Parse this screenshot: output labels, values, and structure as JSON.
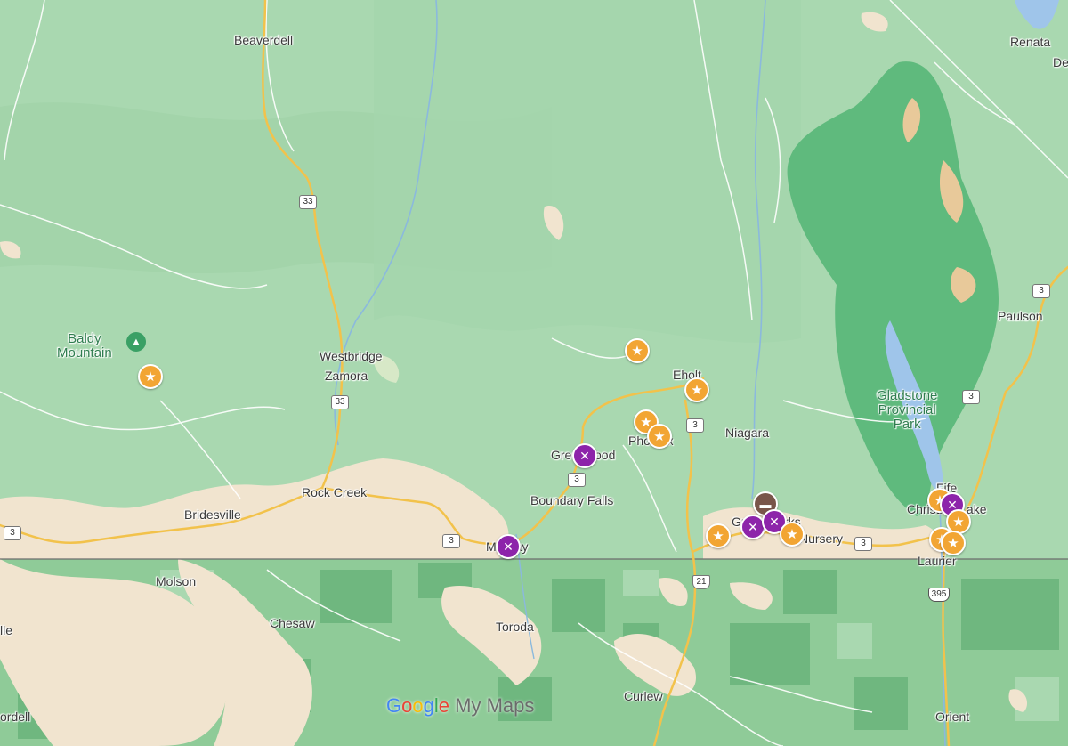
{
  "map": {
    "places": {
      "beaverdell": "Beaverdell",
      "renata": "Renata",
      "de": "De",
      "paulson": "Paulson",
      "baldy_mountain": "Baldy\nMountain",
      "westbridge": "Westbridge",
      "zamora": "Zamora",
      "eholt": "Eholt",
      "niagara": "Niagara",
      "gladstone_park": "Gladstone\nProvincial\nPark",
      "greenwood": "Greenwood",
      "phoenix": "Phoenix",
      "rock_creek": "Rock Creek",
      "bridesville": "Bridesville",
      "boundary_falls": "Boundary Falls",
      "midway": "Midway",
      "fife": "Fife",
      "christina_lake": "Christina Lake",
      "laurier": "Laurier",
      "grand_forks": "Grand Forks",
      "nursery": "Nursery",
      "molson": "Molson",
      "chesaw": "Chesaw",
      "toroda": "Toroda",
      "curlew": "Curlew",
      "orient": "Orient",
      "oroville": "lle",
      "ordell": "ordell"
    },
    "routes": {
      "hwy33a": "33",
      "hwy33b": "33",
      "hwy3a": "3",
      "hwy3b": "3",
      "hwy3c": "3",
      "hwy3d": "3",
      "hwy3e": "3",
      "hwy3f": "3",
      "hwy3g": "3",
      "hwy3h": "3",
      "hwy21": "21",
      "hwy395": "395"
    },
    "markers": [
      {
        "kind": "star",
        "icon": "star-icon"
      },
      {
        "kind": "star",
        "icon": "star-icon"
      },
      {
        "kind": "star",
        "icon": "star-icon"
      },
      {
        "kind": "star",
        "icon": "star-icon"
      },
      {
        "kind": "star",
        "icon": "star-icon"
      },
      {
        "kind": "food",
        "icon": "fork-knife-icon"
      },
      {
        "kind": "food",
        "icon": "fork-knife-icon"
      },
      {
        "kind": "star",
        "icon": "star-icon"
      },
      {
        "kind": "hotel",
        "icon": "bed-icon"
      },
      {
        "kind": "food",
        "icon": "fork-knife-icon"
      },
      {
        "kind": "food",
        "icon": "fork-knife-icon"
      },
      {
        "kind": "star",
        "icon": "star-icon"
      },
      {
        "kind": "star",
        "icon": "star-icon"
      },
      {
        "kind": "food",
        "icon": "fork-knife-icon"
      },
      {
        "kind": "star",
        "icon": "star-icon"
      }
    ],
    "colors": {
      "star": "#f2a533",
      "food": "#8d24aa",
      "hotel": "#79554a",
      "forest": "#a9d8b0",
      "park": "#5fba7d",
      "urban": "#f1e4cf",
      "water": "#9fc5ea",
      "highway": "#f2c24b"
    },
    "brand": {
      "g1": "G",
      "g2": "o",
      "g3": "o",
      "g4": "g",
      "g5": "l",
      "g6": "e",
      "suffix": " My Maps"
    }
  }
}
